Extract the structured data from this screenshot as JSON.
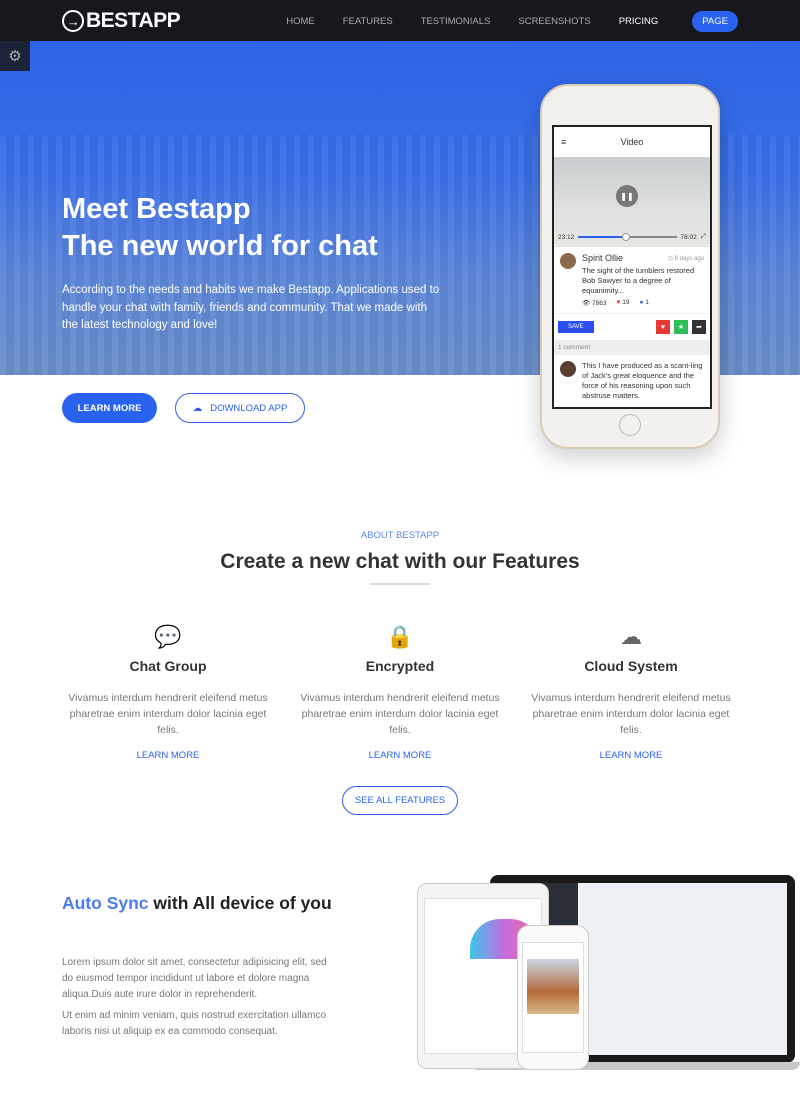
{
  "nav": {
    "logo": "BESTAPP",
    "items": [
      "HOME",
      "FEATURES",
      "TESTIMONIALS",
      "SCREENSHOTS",
      "PRICING"
    ],
    "page_button": "PAGE"
  },
  "hero": {
    "title_line1": "Meet Bestapp",
    "title_line2": "The new world for chat",
    "text": "According to the needs and habits we make Bestapp. Applications used to handle your chat with family, friends and community. That we made with the latest technology and love!",
    "learn_more": "LEARN MORE",
    "download": "DOWNLOAD APP"
  },
  "phone": {
    "header": "Video",
    "time_current": "23:12",
    "time_total": "78:02",
    "author": "Spirit Ollie",
    "ago": "8 days ago",
    "post": "The sight of the tumblers restored Bob Sawyer to a degree of equanimity...",
    "views": "7863",
    "likes": "19",
    "comments_count": "1",
    "save": "SAVE",
    "comments_label": "1 comment",
    "comment": "This I have produced as a scant-ling of Jack's great eloquence and the force of his reasoning upon such abstruse matters."
  },
  "features": {
    "eyebrow": "ABOUT BESTAPP",
    "title": "Create a new chat with our Features",
    "items": [
      {
        "icon": "chat-icon",
        "title": "Chat Group",
        "text": "Vivamus interdum hendrerit eleifend metus pharetrae enim interdum dolor lacinia eget felis.",
        "link": "LEARN MORE"
      },
      {
        "icon": "lock-icon",
        "title": "Encrypted",
        "text": "Vivamus interdum hendrerit eleifend metus pharetrae enim interdum dolor lacinia eget felis.",
        "link": "LEARN MORE"
      },
      {
        "icon": "cloud-icon",
        "title": "Cloud System",
        "text": "Vivamus interdum hendrerit eleifend metus pharetrae enim interdum dolor lacinia eget felis.",
        "link": "LEARN MORE"
      }
    ],
    "see_all": "SEE ALL FEATURES"
  },
  "sync": {
    "title_highlight": "Auto Sync",
    "title_rest": "with All device of you",
    "p1": "Lorem ipsum dolor sit amet, consectetur adipisicing elit, sed do eiusmod tempor incididunt ut labore et dolore magna aliqua.Duis aute irure dolor in reprehenderit.",
    "p2": "Ut enim ad minim veniam, quis nostrud exercitation ullamco laboris nisi ut aliquip ex ea commodo consequat."
  },
  "colors": {
    "accent": "#2a62f0",
    "nav_bg": "#17181d"
  }
}
